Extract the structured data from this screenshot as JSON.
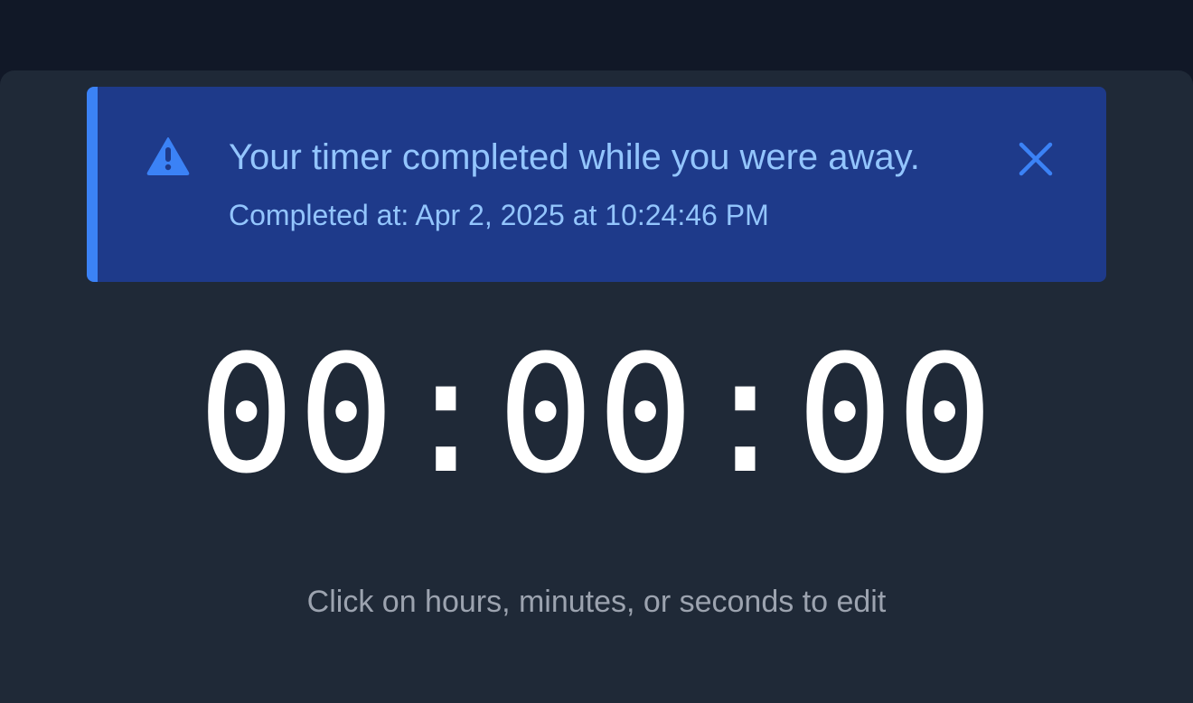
{
  "alert": {
    "title": "Your timer completed while you were away.",
    "completed_text": "Completed at: Apr 2, 2025 at 10:24:46 PM",
    "icon": "warning-icon",
    "close_icon": "close-icon",
    "accent_color": "#3b82f6",
    "background_color": "#1e3a8a",
    "text_color": "#93c5fd"
  },
  "timer": {
    "hours": "00",
    "minutes": "00",
    "seconds": "00",
    "separator": ":"
  },
  "hint": "Click on hours, minutes, or seconds to edit"
}
